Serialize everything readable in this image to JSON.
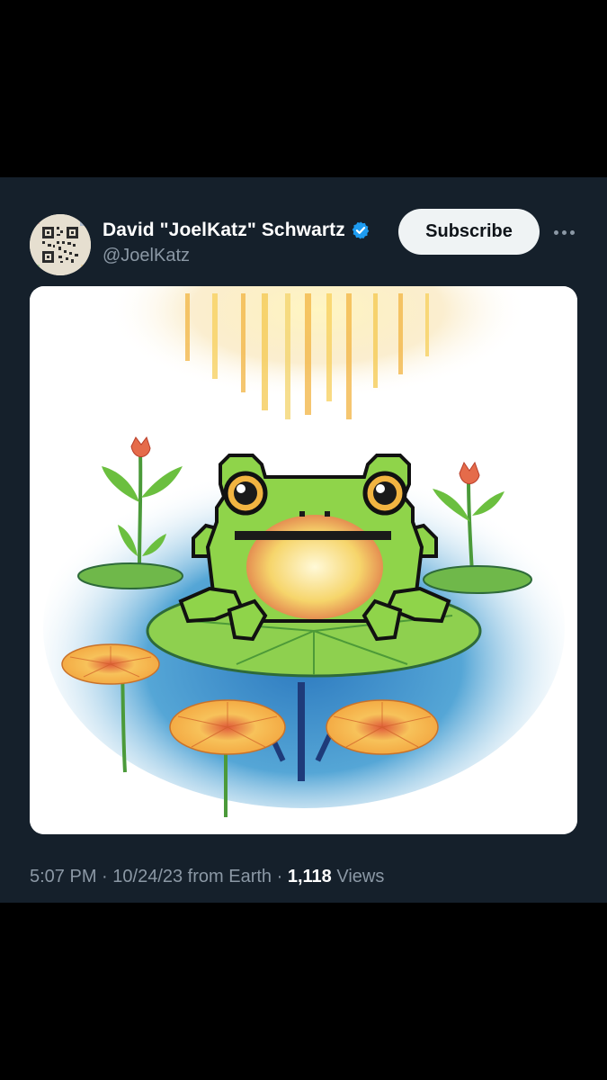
{
  "tweet": {
    "display_name": "David \"JoelKatz\" Schwartz",
    "handle": "@JoelKatz",
    "subscribe_label": "Subscribe",
    "time": "5:07 PM",
    "separator": " · ",
    "date": "10/24/23",
    "source": " from Earth",
    "views_count": "1,118",
    "views_label": " Views"
  },
  "colors": {
    "background": "#000000",
    "card": "#15202b",
    "name": "#ffffff",
    "secondary": "#8b98a5",
    "button_bg": "#eff3f4",
    "verified": "#1d9bf0"
  },
  "icons": {
    "verified": "verified-badge-icon",
    "more": "more-horizontal-icon"
  }
}
